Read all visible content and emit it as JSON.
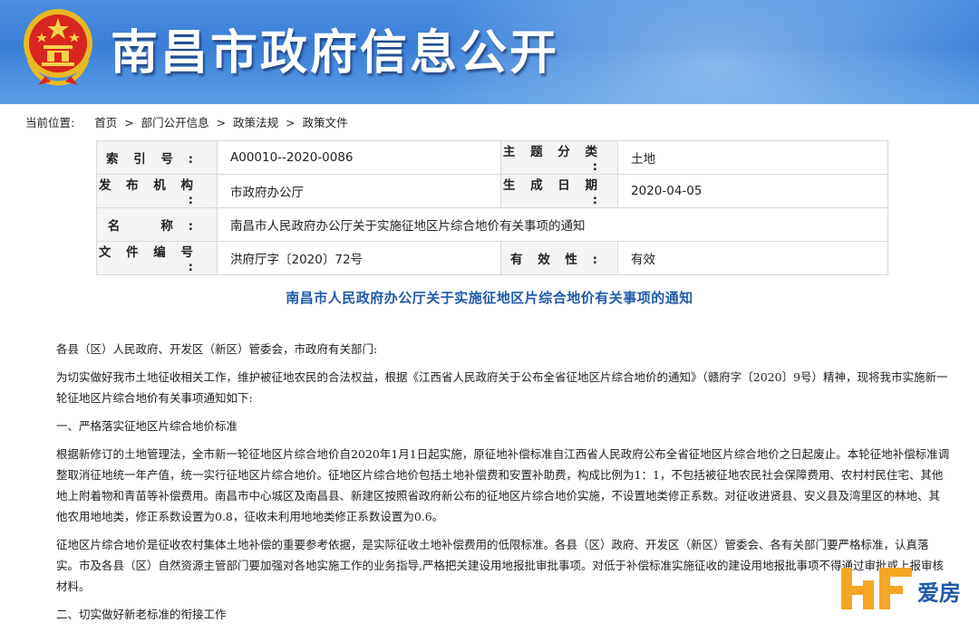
{
  "header": {
    "title": "南昌市政府信息公开",
    "emblem_icon": "national-emblem-icon",
    "bg_color": "#3a7fd7"
  },
  "breadcrumb": {
    "prefix": "当前位置:",
    "items": [
      "首页",
      "部门公开信息",
      "政策法规",
      "政策文件"
    ],
    "separator": ">"
  },
  "meta": {
    "index_label": "索 引 号 :",
    "index_value": "A00010--2020-0086",
    "topic_label": "主 题 分 类 :",
    "topic_value": "土地",
    "issuer_label": "发 布 机 构 :",
    "issuer_value": "市政府办公厅",
    "date_label": "生 成 日 期 :",
    "date_value": "2020-04-05",
    "name_label": "名　　称 :",
    "name_value": "南昌市人民政府办公厅关于实施征地区片综合地价有关事项的通知",
    "docno_label": "文 件 编 号 :",
    "docno_value": "洪府厅字〔2020〕72号",
    "validity_label": "有 效 性 :",
    "validity_value": "有效"
  },
  "document": {
    "title": "南昌市人民政府办公厅关于实施征地区片综合地价有关事项的通知",
    "title_color": "#1f5aa8",
    "salutation": "各县（区）人民政府、开发区（新区）管委会，市政府有关部门:",
    "para1": "为切实做好我市土地征收相关工作，维护被征地农民的合法权益，根据《江西省人民政府关于公布全省征地区片综合地价的通知》（赣府字〔2020〕9号）精神，现将我市实施新一轮征地区片综合地价有关事项通知如下:",
    "section1": "一、严格落实征地区片综合地价标准",
    "para2": "根据新修订的土地管理法，全市新一轮征地区片综合地价自2020年1月1日起实施，原征地补偿标准自江西省人民政府公布全省征地区片综合地价之日起废止。本轮征地补偿标准调整取消征地统一年产值，统一实行征地区片综合地价。征地区片综合地价包括土地补偿费和安置补助费，构成比例为1：1，不包括被征地农民社会保障费用、农村村民住宅、其他地上附着物和青苗等补偿费用。南昌市中心城区及南昌县、新建区按照省政府新公布的征地区片综合地价实施，不设置地类修正系数。对征收进贤县、安义县及湾里区的林地、其他农用地地类，修正系数设置为0.8，征收未利用地地类修正系数设置为0.6。",
    "para3": "征地区片综合地价是征收农村集体土地补偿的重要参考依据，是实际征收土地补偿费用的低限标准。各县（区）政府、开发区（新区）管委会、各有关部门要严格标准，认真落实。市及各县（区）自然资源主管部门要加强对各地实施工作的业务指导,严格把关建设用地报批审批事项。对低于补偿标准实施征收的建设用地报批事项不得通过审批或上报审核材料。",
    "section2": "二、切实做好新老标准的衔接工作"
  },
  "watermark": {
    "text": "爱房",
    "logo_icon": "hf-logo-icon",
    "logo_color": "#f5a623"
  }
}
